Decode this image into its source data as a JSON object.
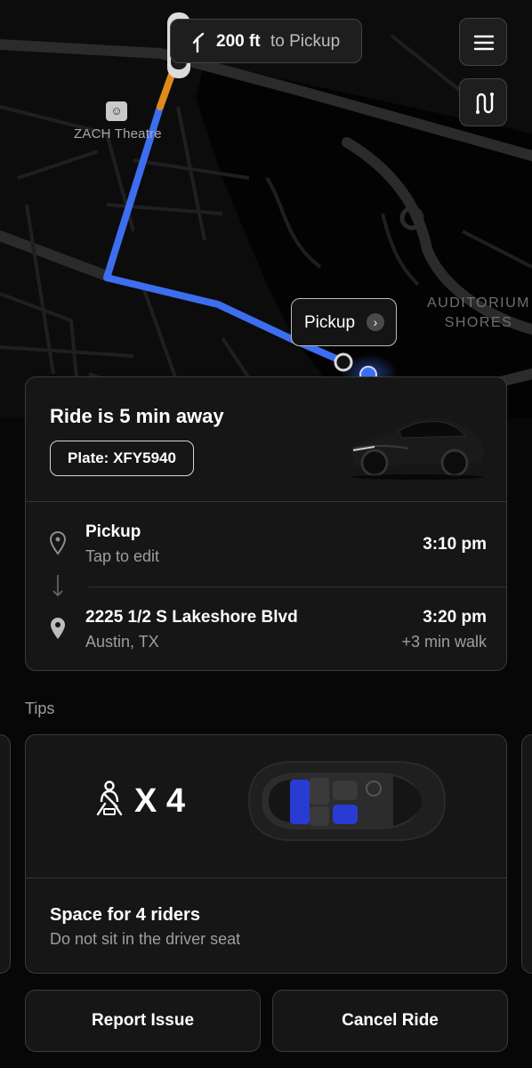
{
  "navigation": {
    "distance": "200 ft",
    "destination": "to Pickup"
  },
  "map": {
    "poi_label": "ZACH Theatre",
    "area_label_line1": "AUDITORIUM",
    "area_label_line2": "SHORES",
    "pickup_bubble_label": "Pickup"
  },
  "ride": {
    "title": "Ride is 5 min away",
    "plate": "Plate: XFY5940",
    "pickup": {
      "title": "Pickup",
      "subtitle": "Tap to edit",
      "time": "3:10 pm"
    },
    "dropoff": {
      "title": "2225 1/2 S Lakeshore Blvd",
      "subtitle": "Austin, TX",
      "time": "3:20 pm",
      "extra": "+3 min walk"
    }
  },
  "tips": {
    "section_label": "Tips",
    "seat_count": "X 4",
    "title": "Space for 4 riders",
    "subtitle": "Do not sit in the driver seat"
  },
  "actions": {
    "report": "Report Issue",
    "cancel": "Cancel Ride"
  },
  "colors": {
    "route_blue": "#3d6ef0",
    "route_orange": "#e08a1e",
    "seat_blue": "#2a3bd4"
  }
}
